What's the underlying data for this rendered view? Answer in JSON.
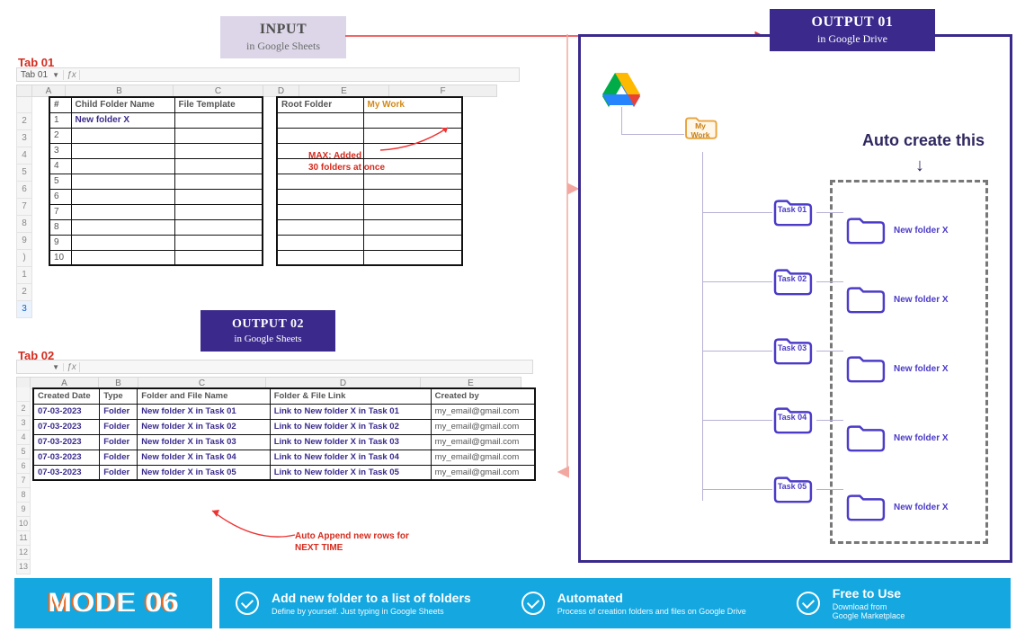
{
  "badges": {
    "input": {
      "title": "INPUT",
      "sub": "in Google Sheets"
    },
    "out1": {
      "title": "OUTPUT 01",
      "sub": "in Google Drive"
    },
    "out2": {
      "title": "OUTPUT 02",
      "sub": "in Google Sheets"
    }
  },
  "tabs": {
    "t1": "Tab 01",
    "t2": "Tab 02"
  },
  "sheet1": {
    "cellref": "Tab 01",
    "colLetters": [
      "A",
      "B",
      "C",
      "D",
      "E",
      "F"
    ],
    "left": {
      "h1": "#",
      "h2": "Child Folder Name",
      "h3": "File Template",
      "row1": "New folder X"
    },
    "right": {
      "h1": "Root Folder",
      "h2": "My Work"
    },
    "note": "MAX: Added\n30 folders at once",
    "rowNums": [
      "",
      "2",
      "3",
      "4",
      "5",
      "6",
      "7",
      "8",
      "9",
      ")",
      "1",
      "2",
      "3"
    ]
  },
  "sheet2": {
    "colLetters": [
      "A",
      "B",
      "C",
      "D",
      "E"
    ],
    "headers": [
      "Created Date",
      "Type",
      "Folder and File Name",
      "Folder & File Link",
      "Created by"
    ],
    "rows": [
      [
        "07-03-2023",
        "Folder",
        "New folder X in Task 01",
        "Link to New folder X in Task 01",
        "my_email@gmail.com"
      ],
      [
        "07-03-2023",
        "Folder",
        "New folder X in Task 02",
        "Link to New folder X in Task 02",
        "my_email@gmail.com"
      ],
      [
        "07-03-2023",
        "Folder",
        "New folder X in Task 03",
        "Link to New folder X in Task 03",
        "my_email@gmail.com"
      ],
      [
        "07-03-2023",
        "Folder",
        "New folder X in Task 04",
        "Link to New folder X in Task 04",
        "my_email@gmail.com"
      ],
      [
        "07-03-2023",
        "Folder",
        "New folder X in Task 05",
        "Link to New folder X in Task 05",
        "my_email@gmail.com"
      ]
    ],
    "rowNums": [
      "",
      "2",
      "3",
      "4",
      "5",
      "6",
      "7",
      "8",
      "9",
      "10",
      "11",
      "12",
      "13"
    ],
    "note": "Auto Append new rows for\nNEXT TIME"
  },
  "drive": {
    "autoTitle": "Auto create this",
    "root": "My\nWork",
    "tasks": [
      "Task 01",
      "Task 02",
      "Task 03",
      "Task 04",
      "Task 05"
    ],
    "newFolder": "New folder X"
  },
  "footer": {
    "mode": "MODE 06",
    "f1": {
      "h": "Add new folder to a list of  folders",
      "s": "Define by yourself. Just typing in Google Sheets"
    },
    "f2": {
      "h": "Automated",
      "s": "Process of creation folders and files on Google Drive"
    },
    "f3": {
      "h": "Free to Use",
      "s": "Download from\nGoogle Marketplace"
    }
  }
}
